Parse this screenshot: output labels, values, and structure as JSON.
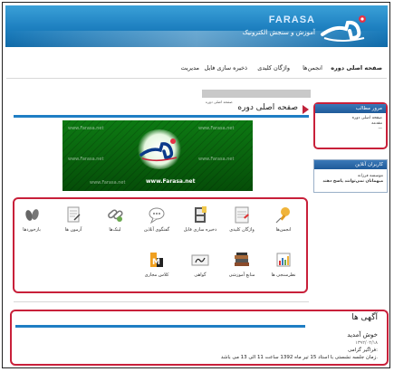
{
  "header": {
    "brand_latin": "FARASA",
    "tagline": "آموزش و سنجش الکترونیک",
    "colors": {
      "header": "#1d7fbf",
      "accent": "#c8203a",
      "bar": "#1f7ec4"
    }
  },
  "nav": {
    "items": [
      {
        "label": "صفحه اصلی دوره",
        "icon": "home-icon"
      },
      {
        "label": "انجمن‌ها"
      },
      {
        "label": "واژگان کلیدی"
      },
      {
        "label": "ذخیره سازی فایل"
      },
      {
        "label": "مدیریت"
      }
    ]
  },
  "breadcrumb": {
    "text": "صفحه اصلی دوره"
  },
  "main": {
    "title": "صفحه اصلی دوره",
    "banner": {
      "url": "www.Farasa.net",
      "logo_text": "فرا"
    }
  },
  "sidebar": {
    "summary": {
      "title": "مرور مطالب",
      "lines": [
        "صفحه اصلی دوره",
        "مقدمه",
        "—"
      ]
    },
    "online": {
      "title": "کاربران آنلاین",
      "lines": [
        "موسسه فرزانه",
        "میهمانان نمی‌توانند پاسخ دهند"
      ]
    }
  },
  "icons": {
    "row1": [
      {
        "label": "انجمن‌ها",
        "icon": "pushpin-icon"
      },
      {
        "label": "واژگان کلیدی",
        "icon": "notepad-icon"
      },
      {
        "label": "ذخیره سازی فایل",
        "icon": "file-cabinet-icon"
      },
      {
        "label": "گفتگوی آنلاین",
        "icon": "chat-icon"
      },
      {
        "label": "لینک‌ها",
        "icon": "link-icon"
      },
      {
        "label": "آزمون ها",
        "icon": "test-icon"
      },
      {
        "label": "بازخوردها",
        "icon": "feedback-icon"
      }
    ],
    "row2": [
      {
        "label": "نظرسنجی ها",
        "icon": "poll-icon"
      },
      {
        "label": "منابع آموزشی",
        "icon": "books-icon"
      },
      {
        "label": "گواهی",
        "icon": "certificate-icon"
      },
      {
        "label": "کلاس مجازی",
        "icon": "virtual-class-icon"
      }
    ]
  },
  "ads": {
    "title": "آگهی ها",
    "welcome": "خوش آمدید",
    "date": "۱۳۹۲/۰۲/۱۸",
    "heading": "فراگیر گرامی:",
    "body": "زمان جلسه نشستی با استاد 15 تیر ماه 1392 ساعت 11 الی 13 می باشد."
  }
}
